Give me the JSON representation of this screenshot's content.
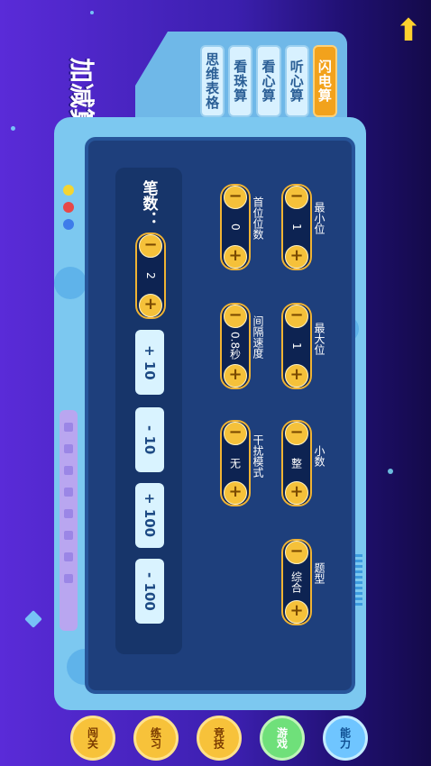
{
  "app_title": "加减算",
  "tabs": [
    {
      "label": "闪电算",
      "active": true
    },
    {
      "label": "听心算",
      "active": false
    },
    {
      "label": "看心算",
      "active": false
    },
    {
      "label": "看珠算",
      "active": false
    },
    {
      "label": "思维表格",
      "active": false
    }
  ],
  "count": {
    "label": "笔数：",
    "value": "2"
  },
  "quick_buttons": [
    "+ 10",
    "- 10",
    "+ 100",
    "- 100"
  ],
  "settings": [
    {
      "label": "最小位",
      "value": "1"
    },
    {
      "label": "最大位",
      "value": "1"
    },
    {
      "label": "小数",
      "value": "整"
    },
    {
      "label": "题型",
      "value": "综合"
    },
    {
      "label": "首位位数",
      "value": "0"
    },
    {
      "label": "间隔速度",
      "value": "0.8秒"
    },
    {
      "label": "干扰模式",
      "value": "无"
    }
  ],
  "bottom_nav": [
    "闯关",
    "练习",
    "竞技",
    "游戏",
    "能力"
  ],
  "icons": {
    "up": "up-arrow-icon",
    "minus": "minus-icon",
    "plus": "plus-icon"
  },
  "colors": {
    "accent": "#f5c13a",
    "active_tab": "#f2a21c",
    "panel": "#1e3f7c"
  }
}
